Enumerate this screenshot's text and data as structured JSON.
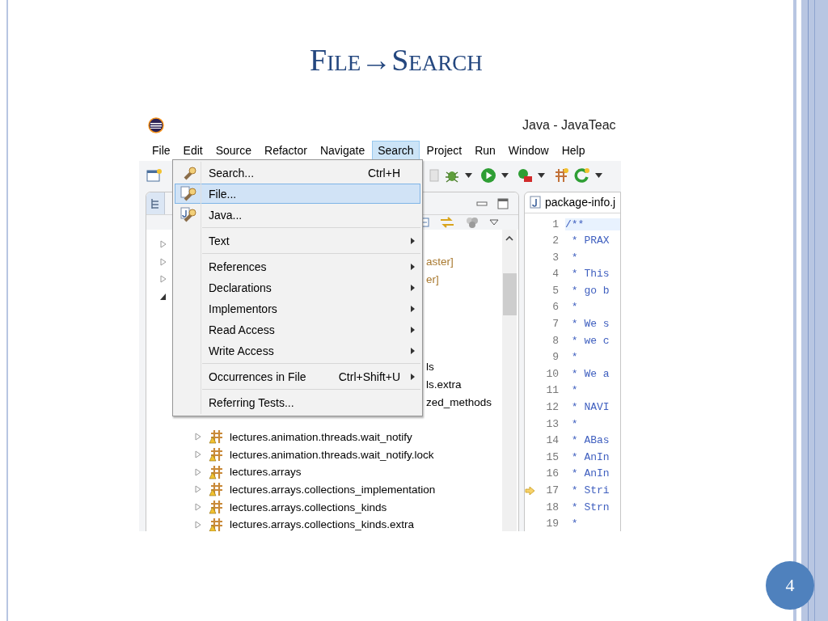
{
  "slide": {
    "title": "File→Search",
    "page_number": "4"
  },
  "window": {
    "title": "Java - JavaTeac"
  },
  "menubar": [
    {
      "label": "File",
      "selected": false
    },
    {
      "label": "Edit",
      "selected": false
    },
    {
      "label": "Source",
      "selected": false
    },
    {
      "label": "Refactor",
      "selected": false
    },
    {
      "label": "Navigate",
      "selected": false
    },
    {
      "label": "Search",
      "selected": true
    },
    {
      "label": "Project",
      "selected": false
    },
    {
      "label": "Run",
      "selected": false
    },
    {
      "label": "Window",
      "selected": false
    },
    {
      "label": "Help",
      "selected": false
    }
  ],
  "menu": {
    "sections": [
      [
        {
          "label": "Search...",
          "shortcut": "Ctrl+H",
          "submenu": false,
          "selected": false
        },
        {
          "label": "File...",
          "submenu": false,
          "selected": true
        },
        {
          "label": "Java...",
          "submenu": false,
          "selected": false
        }
      ],
      [
        {
          "label": "Text",
          "submenu": true,
          "selected": false
        }
      ],
      [
        {
          "label": "References",
          "submenu": true,
          "selected": false
        },
        {
          "label": "Declarations",
          "submenu": true,
          "selected": false
        },
        {
          "label": "Implementors",
          "submenu": true,
          "selected": false
        },
        {
          "label": "Read Access",
          "submenu": true,
          "selected": false
        },
        {
          "label": "Write Access",
          "submenu": true,
          "selected": false
        }
      ],
      [
        {
          "label": "Occurrences in File",
          "shortcut": "Ctrl+Shift+U",
          "submenu": true,
          "selected": false
        }
      ],
      [
        {
          "label": "Referring Tests...",
          "submenu": false,
          "selected": false
        }
      ]
    ]
  },
  "explorer": {
    "tree": [
      {
        "kind": "covered",
        "expanded": false
      },
      {
        "kind": "fragment",
        "expanded": false,
        "text": "aster]",
        "color": "#a8782e"
      },
      {
        "kind": "fragment",
        "expanded": false,
        "text": "er]",
        "color": "#a8782e"
      },
      {
        "kind": "covered",
        "expanded": true,
        "children": [
          {
            "kind": "hidden"
          },
          {
            "kind": "hidden"
          },
          {
            "kind": "hidden"
          },
          {
            "kind": "fragment",
            "text": "ls",
            "color": "#000000"
          },
          {
            "kind": "fragment",
            "text": "ls.extra",
            "color": "#000000"
          },
          {
            "kind": "fragment",
            "text": "zed_methods",
            "color": "#000000"
          },
          {
            "kind": "hidden"
          },
          {
            "kind": "full",
            "expanded": false,
            "text": "lectures.animation.threads.wait_notify"
          },
          {
            "kind": "full",
            "expanded": false,
            "text": "lectures.animation.threads.wait_notify.lock"
          },
          {
            "kind": "full",
            "expanded": false,
            "text": "lectures.arrays"
          },
          {
            "kind": "full",
            "expanded": false,
            "text": "lectures.arrays.collections_implementation"
          },
          {
            "kind": "full",
            "expanded": false,
            "text": "lectures.arrays.collections_kinds"
          },
          {
            "kind": "full",
            "expanded": false,
            "text": "lectures.arrays.collections_kinds.extra"
          }
        ]
      }
    ]
  },
  "editor": {
    "tab": "package-info.j",
    "lines": [
      {
        "number": "1",
        "text": "/**",
        "current": true,
        "marker": false
      },
      {
        "number": "2",
        "text": " * PRAX",
        "current": false,
        "marker": false
      },
      {
        "number": "3",
        "text": " *",
        "current": false,
        "marker": false
      },
      {
        "number": "4",
        "text": " * This",
        "current": false,
        "marker": false
      },
      {
        "number": "5",
        "text": " * go b",
        "current": false,
        "marker": false
      },
      {
        "number": "6",
        "text": " *",
        "current": false,
        "marker": false
      },
      {
        "number": "7",
        "text": " * We s",
        "current": false,
        "marker": false
      },
      {
        "number": "8",
        "text": " * we c",
        "current": false,
        "marker": false
      },
      {
        "number": "9",
        "text": " *",
        "current": false,
        "marker": false
      },
      {
        "number": "10",
        "text": " * We a",
        "current": false,
        "marker": false
      },
      {
        "number": "11",
        "text": " *",
        "current": false,
        "marker": false
      },
      {
        "number": "12",
        "text": " * NAVI",
        "current": false,
        "marker": false
      },
      {
        "number": "13",
        "text": " *",
        "current": false,
        "marker": false
      },
      {
        "number": "14",
        "text": " * ABas",
        "current": false,
        "marker": false
      },
      {
        "number": "15",
        "text": " * AnIn",
        "current": false,
        "marker": false
      },
      {
        "number": "16",
        "text": " * AnIn",
        "current": false,
        "marker": false
      },
      {
        "number": "17",
        "text": " * Stri",
        "current": false,
        "marker": true
      },
      {
        "number": "18",
        "text": " * Strn",
        "current": false,
        "marker": false
      },
      {
        "number": "19",
        "text": " *",
        "current": false,
        "marker": false
      }
    ]
  }
}
